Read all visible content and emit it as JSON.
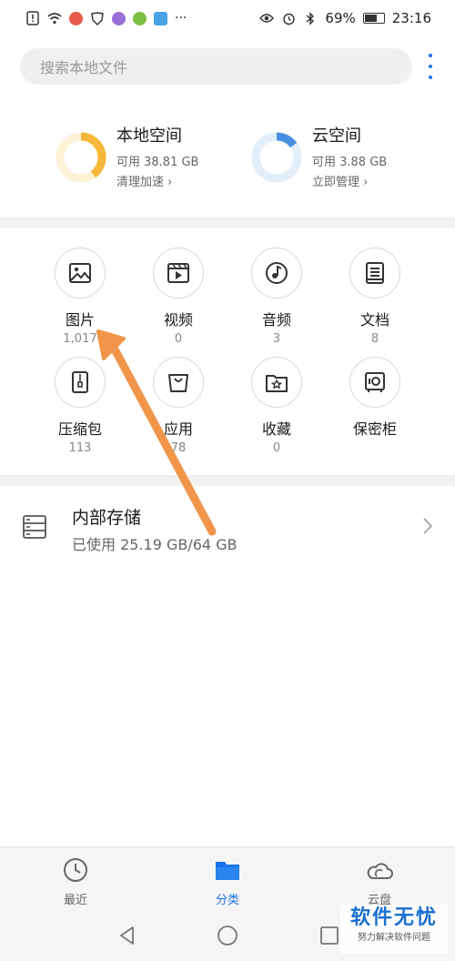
{
  "status_bar": {
    "battery": "69%",
    "time": "23:16",
    "more": "···"
  },
  "search": {
    "placeholder": "搜索本地文件"
  },
  "storage": {
    "local": {
      "title": "本地空间",
      "available": "可用 38.81 GB",
      "action": "清理加速",
      "used_fraction": 0.4,
      "color": "#f5b83a"
    },
    "cloud": {
      "title": "云空间",
      "available": "可用 3.88 GB",
      "action": "立即管理",
      "used_fraction": 0.15,
      "color": "#4a90e2"
    }
  },
  "categories": [
    {
      "label": "图片",
      "count": "1,017",
      "icon": "image-icon"
    },
    {
      "label": "视频",
      "count": "0",
      "icon": "video-icon"
    },
    {
      "label": "音频",
      "count": "3",
      "icon": "audio-icon"
    },
    {
      "label": "文档",
      "count": "8",
      "icon": "document-icon"
    },
    {
      "label": "压缩包",
      "count": "113",
      "icon": "zip-icon"
    },
    {
      "label": "应用",
      "count": "78",
      "icon": "app-bag-icon"
    },
    {
      "label": "收藏",
      "count": "0",
      "icon": "star-folder-icon"
    },
    {
      "label": "保密柜",
      "count": "",
      "icon": "safe-icon"
    }
  ],
  "internal_storage": {
    "title": "内部存储",
    "usage": "已使用 25.19 GB/64 GB"
  },
  "bottom_nav": {
    "items": [
      {
        "label": "最近",
        "icon": "clock-icon"
      },
      {
        "label": "分类",
        "icon": "folder-icon",
        "active": true
      },
      {
        "label": "云盘",
        "icon": "cloud-icon"
      }
    ]
  },
  "watermark": {
    "title": "软件无忧",
    "subtitle": "努力解决软件问题"
  },
  "colors": {
    "accent": "#1a73e8",
    "annotation_arrow": "#f0954a"
  }
}
